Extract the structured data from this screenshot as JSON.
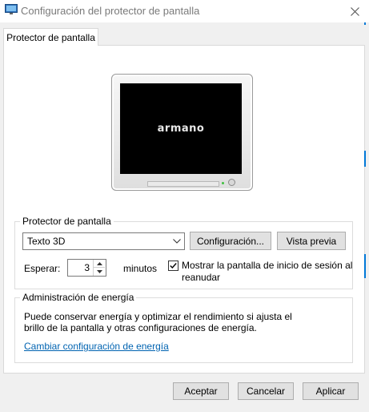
{
  "window": {
    "title": "Configuración del protector de pantalla",
    "close_icon": "close-icon"
  },
  "tabs": [
    {
      "label": "Protector de pantalla",
      "active": true
    }
  ],
  "preview": {
    "screen_text": "armano"
  },
  "screensaver_group": {
    "legend": "Protector de pantalla",
    "selected": "Texto 3D",
    "settings_button": "Configuración...",
    "preview_button": "Vista previa",
    "wait_label": "Esperar:",
    "wait_value": "3",
    "wait_unit": "minutos",
    "resume_checkbox": {
      "checked": true,
      "line1": "Mostrar la pantalla de inicio de sesión al",
      "line2": "reanudar"
    }
  },
  "power_group": {
    "legend": "Administración de energía",
    "description_line1": "Puede conservar energía y optimizar el rendimiento si ajusta el",
    "description_line2": "brillo de la pantalla y otras configuraciones de energía.",
    "link": "Cambiar configuración de energía"
  },
  "footer": {
    "ok": "Aceptar",
    "cancel": "Cancelar",
    "apply": "Aplicar"
  },
  "colors": {
    "link": "#0063b1",
    "accent": "#0078d7"
  }
}
